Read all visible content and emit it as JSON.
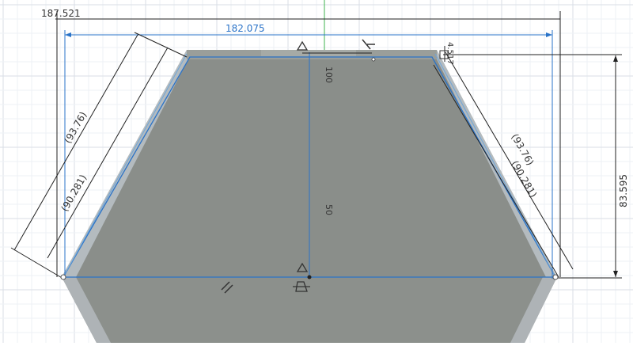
{
  "dimensions": {
    "overall_width": "187.521",
    "inner_width": "182.075",
    "height": "83.595",
    "small_offset": "4.517",
    "left_outer_slant": "(93.76)",
    "left_inner_slant": "(90.281)",
    "right_outer_slant": "(93.76)",
    "right_inner_slant": "(90.281)"
  },
  "ruler_labels": {
    "upper": "100",
    "middle": "50"
  },
  "colors": {
    "background": "#ffffff",
    "grid_minor": "#eef1f5",
    "grid_major": "#d9dee6",
    "body_fill": "#8c908c",
    "body_edge": "#aeb6bb",
    "sketch_line": "#2a73c8",
    "dimension_line": "#222222",
    "green_axis": "#3fb34f"
  },
  "icons": [
    "constraint-triangle-icon",
    "coincident-icon",
    "parallel-icon",
    "horizontal-constraint-icon",
    "fix-lock-icon"
  ]
}
